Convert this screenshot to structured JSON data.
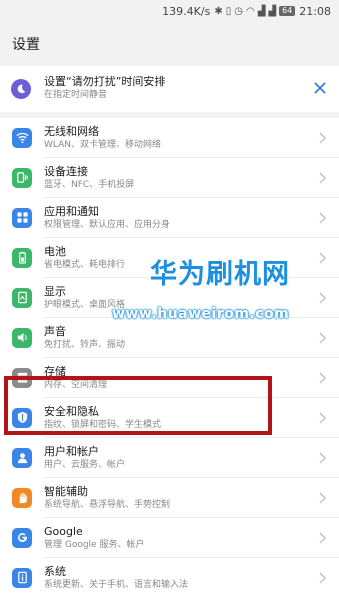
{
  "status_bar": {
    "speed": "139.4K/s",
    "battery": "64",
    "time": "21:08"
  },
  "header": {
    "title": "设置"
  },
  "dnd": {
    "title": "设置“请勿打扰”时间安排",
    "subtitle": "在指定时间静音",
    "icon": "moon-icon",
    "close_icon": "close-icon"
  },
  "items": [
    {
      "title": "无线和网络",
      "subtitle": "WLAN、双卡管理、移动网络",
      "icon": "wifi-icon",
      "color": "#3a86e8"
    },
    {
      "title": "设备连接",
      "subtitle": "蓝牙、NFC、手机投屏",
      "icon": "device-link-icon",
      "color": "#3cb76a"
    },
    {
      "title": "应用和通知",
      "subtitle": "权限管理、默认应用、应用分身",
      "icon": "apps-icon",
      "color": "#3a86e8"
    },
    {
      "title": "电池",
      "subtitle": "省电模式、耗电排行",
      "icon": "battery-icon",
      "color": "#3cb76a"
    },
    {
      "title": "显示",
      "subtitle": "护眼模式、桌面风格",
      "icon": "display-icon",
      "color": "#3cb76a"
    },
    {
      "title": "声音",
      "subtitle": "免打扰、铃声、振动",
      "icon": "sound-icon",
      "color": "#3cb76a"
    },
    {
      "title": "存储",
      "subtitle": "内存、空间清理",
      "icon": "storage-icon",
      "color": "#8a8a8a"
    },
    {
      "title": "安全和隐私",
      "subtitle": "指纹、锁屏和密码、学生模式",
      "icon": "shield-icon",
      "color": "#3a86e8"
    },
    {
      "title": "用户和帐户",
      "subtitle": "用户、云服务、帐户",
      "icon": "user-icon",
      "color": "#3a86e8"
    },
    {
      "title": "智能辅助",
      "subtitle": "系统导航、悬浮导航、手势控制",
      "icon": "hand-icon",
      "color": "#f08a24"
    },
    {
      "title": "Google",
      "subtitle": "管理 Google 服务、帐户",
      "icon": "google-icon",
      "color": "#3a86e8"
    },
    {
      "title": "系统",
      "subtitle": "系统更新、关于手机、语言和输入法",
      "icon": "info-icon",
      "color": "#3a86e8"
    }
  ],
  "watermark": {
    "title": "华为刷机网",
    "url": "www.huaweirom.com"
  }
}
